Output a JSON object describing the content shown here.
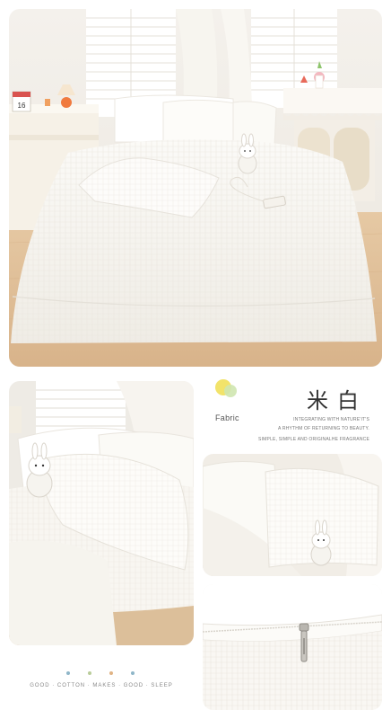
{
  "hero_scene": {
    "calendar_date": "16"
  },
  "info": {
    "fabric_label": "Fabric",
    "color_name": "米白",
    "tagline_1": "INTEGRATING WITH NATURE'IT'S",
    "tagline_2": "A RHYTHM OF RETURNING TO BEAUTY.",
    "tagline_3": "SIMPLE, SIMPLE AND ORIGINALHE FRAGRANCE",
    "swatch_colors": [
      "#f2e36a",
      "#cfe6b0"
    ]
  },
  "footer": {
    "slogan": "GOOD · COTTON · MAKES · GOOD · SLEEP",
    "dot_colors": [
      "#8fb6c8",
      "#b9cc9a",
      "#e0b384",
      "#8fb6c8"
    ]
  }
}
